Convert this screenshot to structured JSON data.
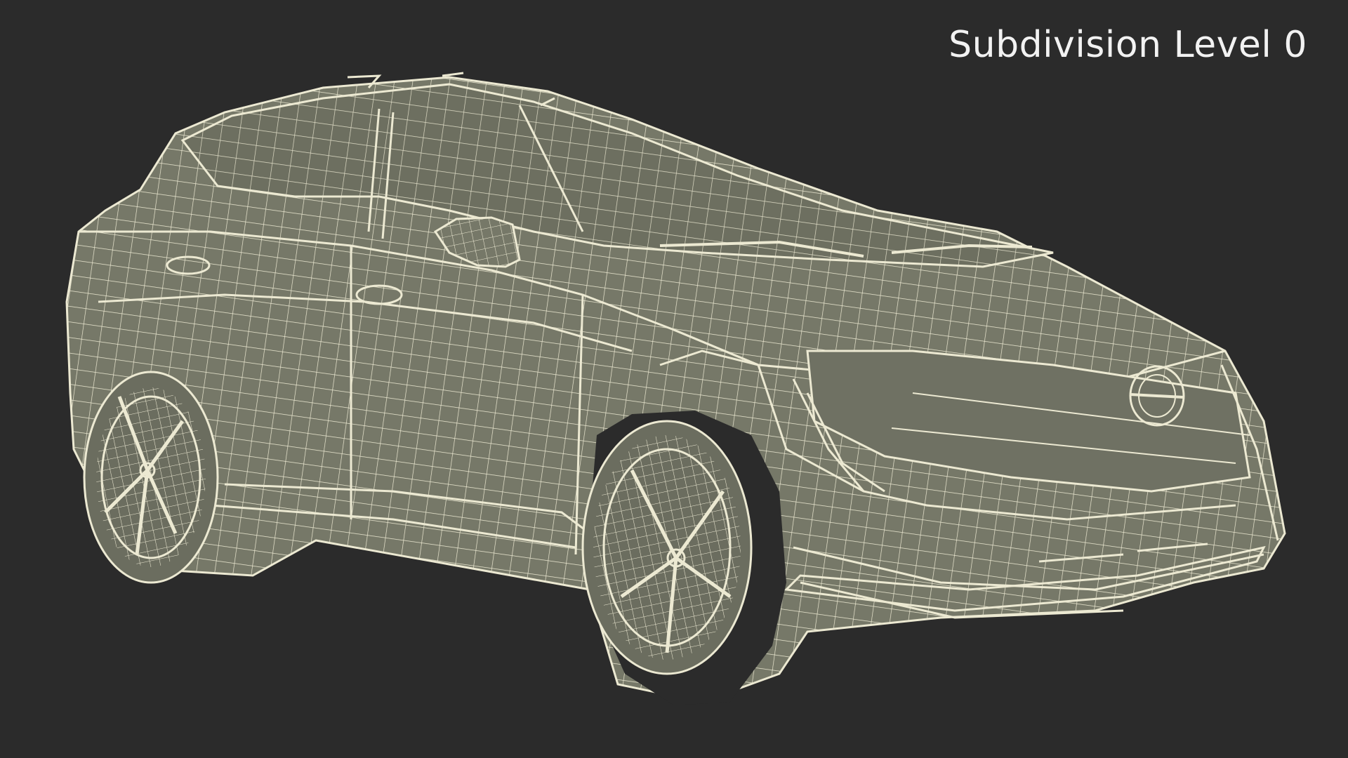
{
  "viewport": {
    "background_color": "#2b2b2b",
    "wire_color": "#ece9d2",
    "surface_color": "#767868"
  },
  "overlay": {
    "subdivision_label": "Subdivision Level 0"
  },
  "model": {
    "icon": "wireframe-car-icon"
  }
}
